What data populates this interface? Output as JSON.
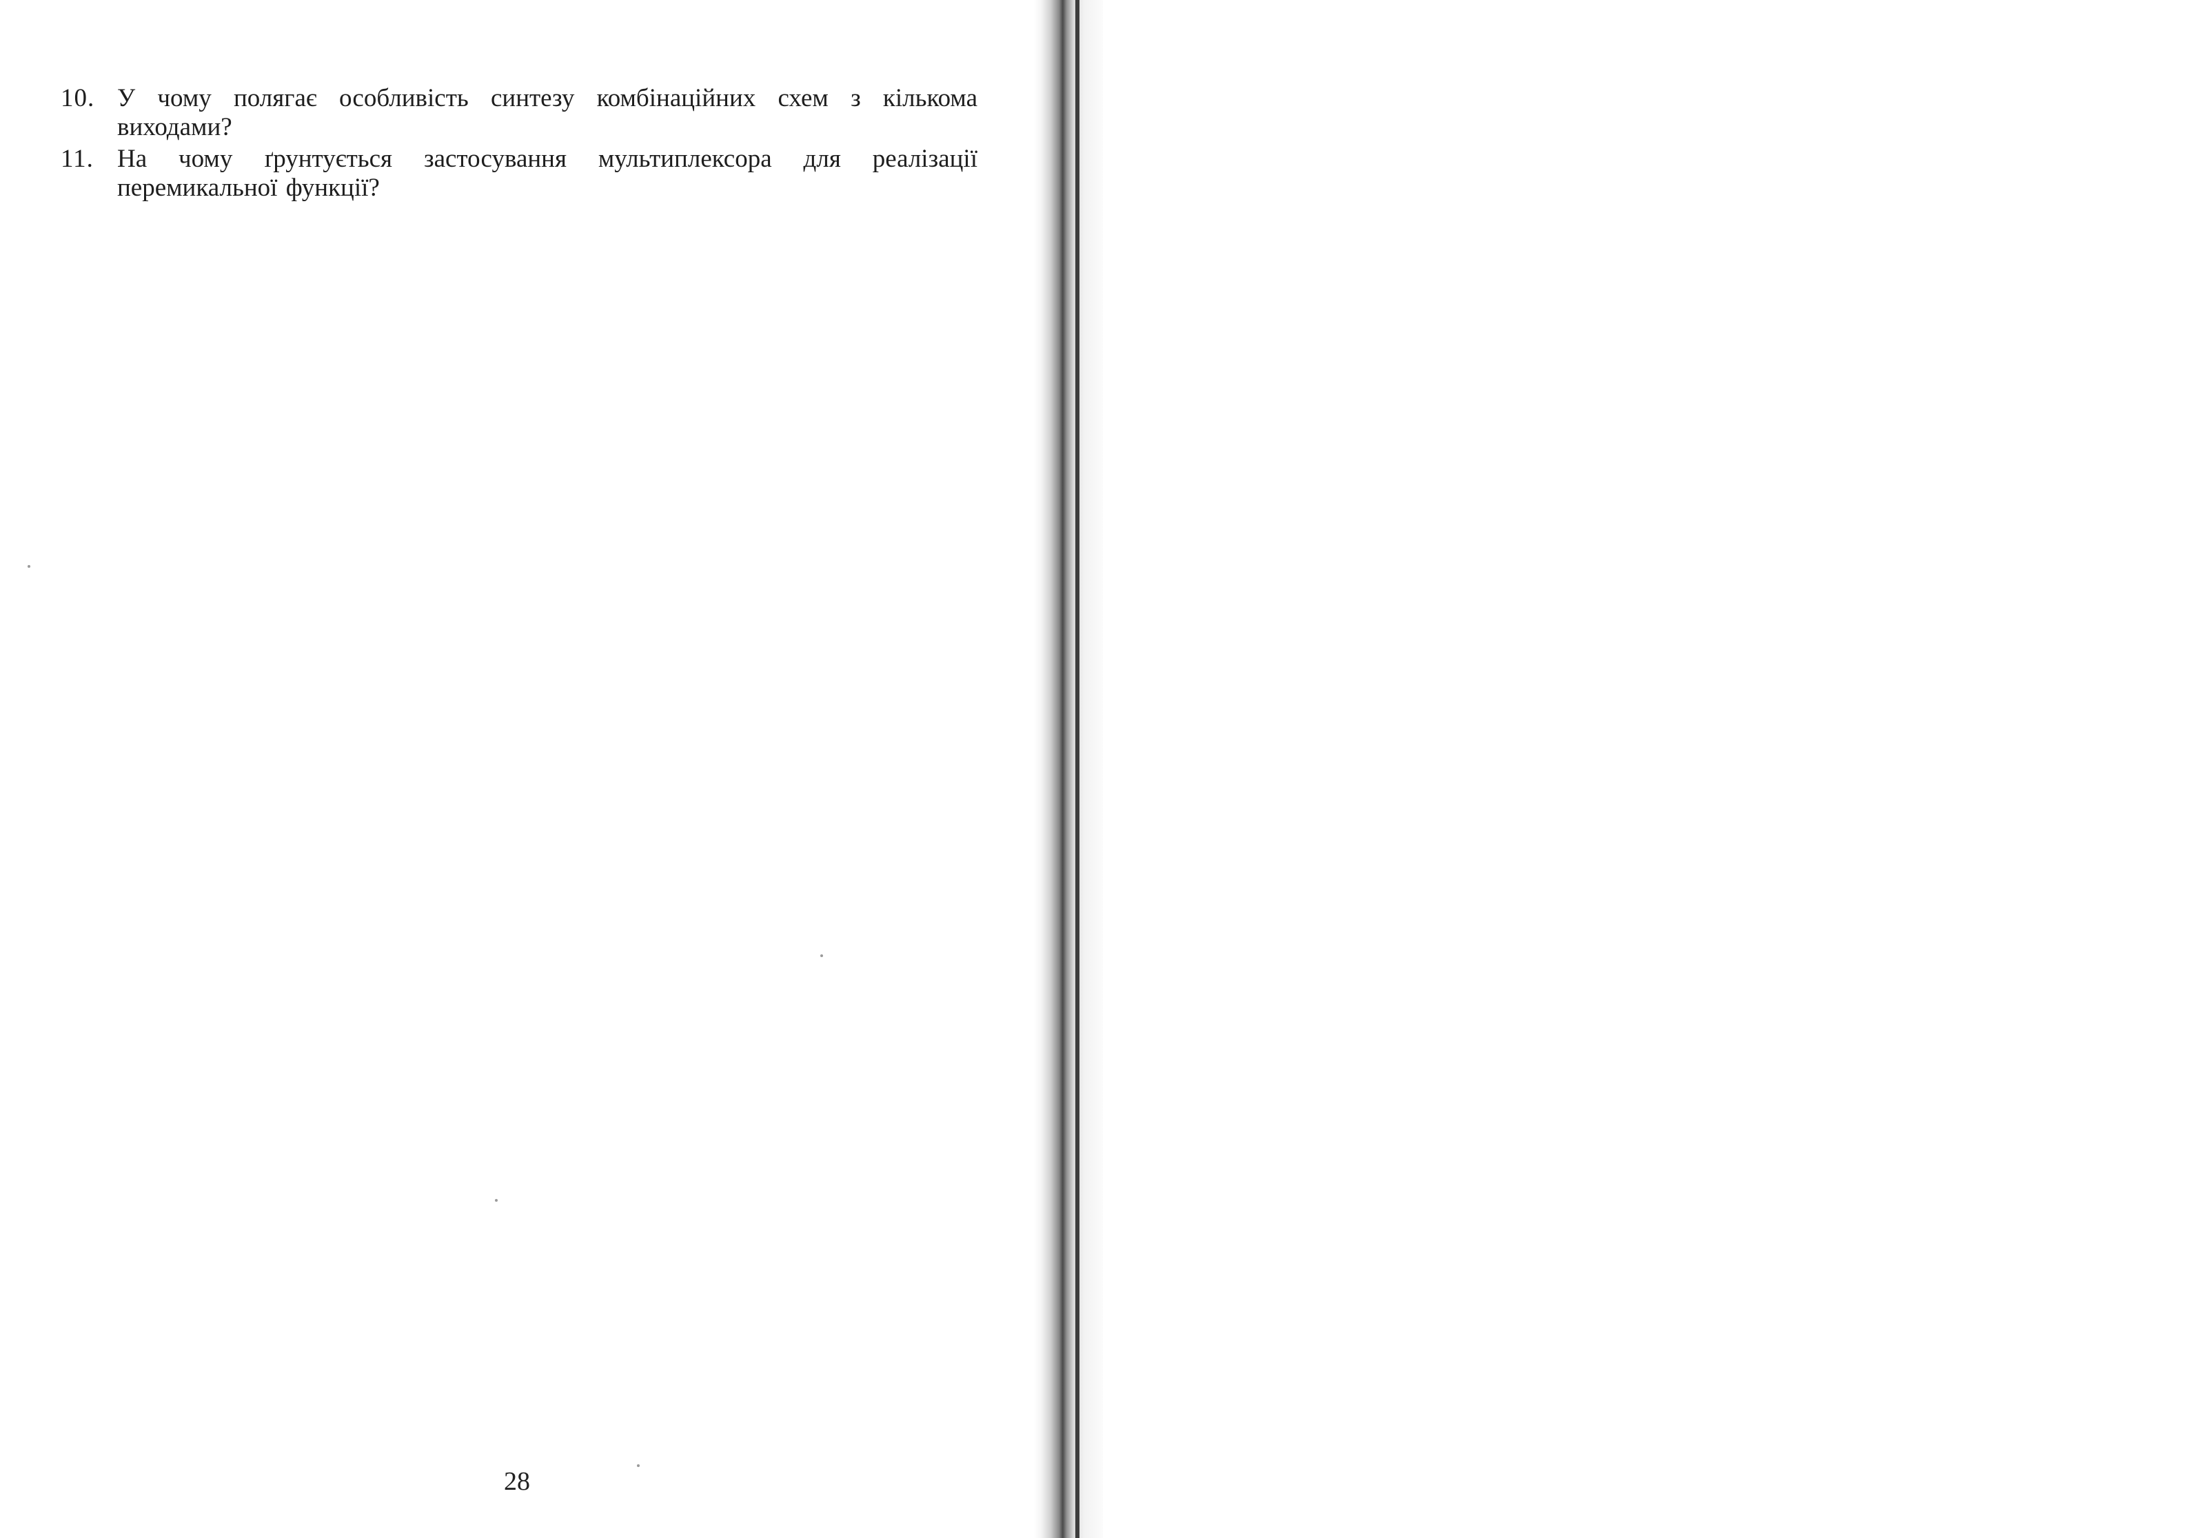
{
  "questions": [
    {
      "number": "10.",
      "text": "У чому полягає особливість синтезу комбінаційних схем з кількома виходами?"
    },
    {
      "number": "11.",
      "text": "На чому ґрунтується застосування мультиплексора для реалізації перемикальної функції?"
    }
  ],
  "page_number": "28"
}
